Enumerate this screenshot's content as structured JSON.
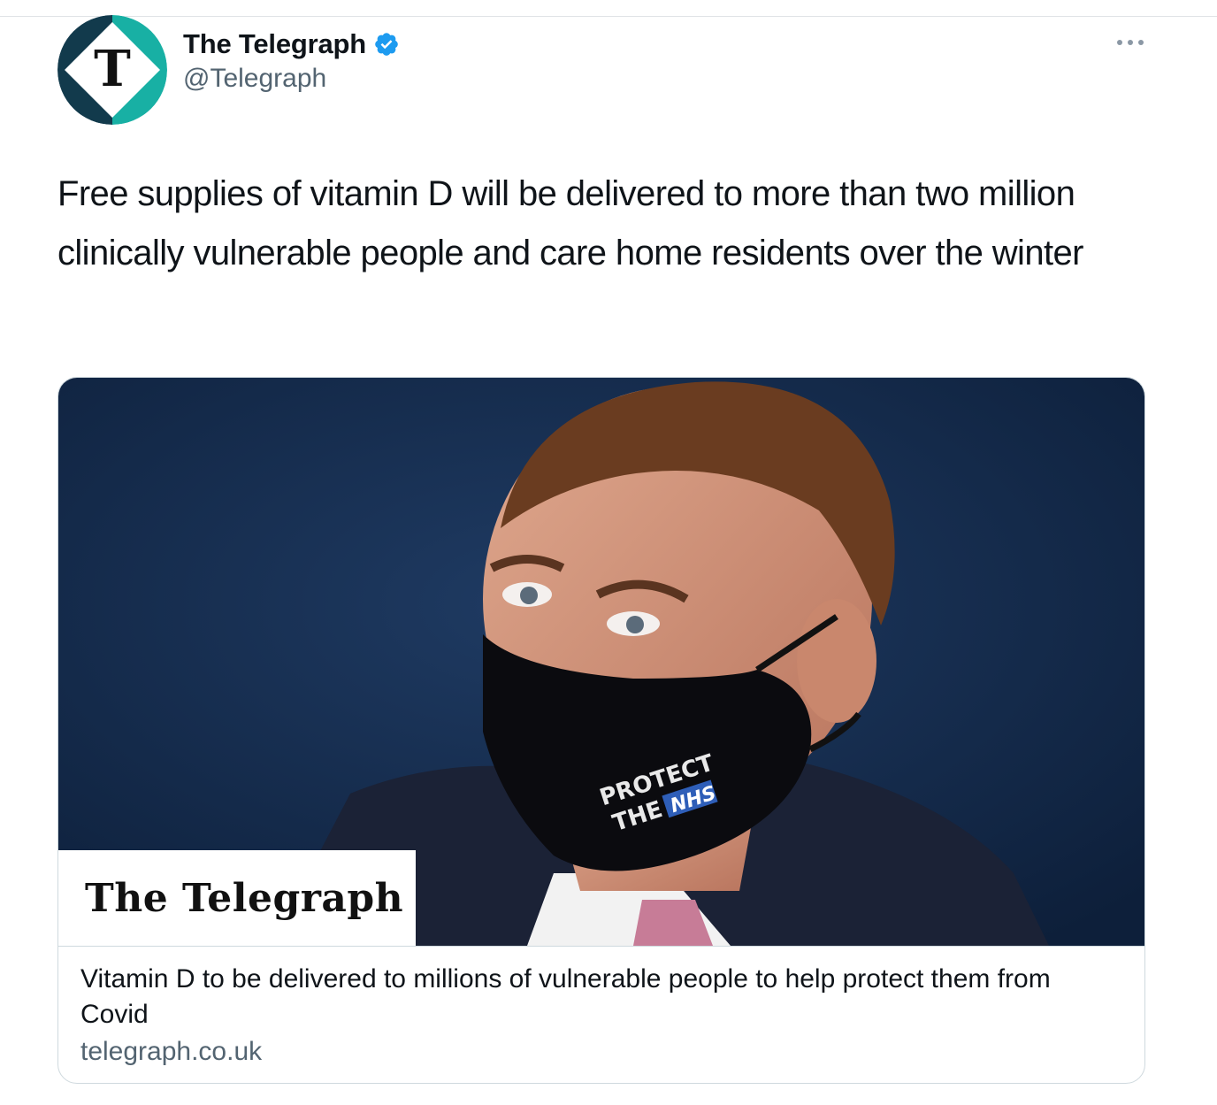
{
  "colors": {
    "verified": "#1d9bf0",
    "text_primary": "#0f1419",
    "text_secondary": "#536471",
    "card_border": "#cfd9de",
    "avatar_teal": "#18b0a4",
    "avatar_navy": "#123a4c"
  },
  "author": {
    "display_name": "The Telegraph",
    "handle": "@Telegraph",
    "avatar_letter": "T",
    "verified_icon": "verified-badge-icon"
  },
  "more_icon": "more-options-icon",
  "tweet": {
    "text": "Free supplies of vitamin D will be delivered to more than two million clinically vulnerable people and care home residents over the winter"
  },
  "link_card": {
    "image_brand": "The Telegraph",
    "mask_text_line1": "PROTECT",
    "mask_text_line2": "THE",
    "mask_text_badge": "NHS",
    "title": "Vitamin D to be delivered to millions of vulnerable people to help protect them from Covid",
    "domain": "telegraph.co.uk"
  }
}
